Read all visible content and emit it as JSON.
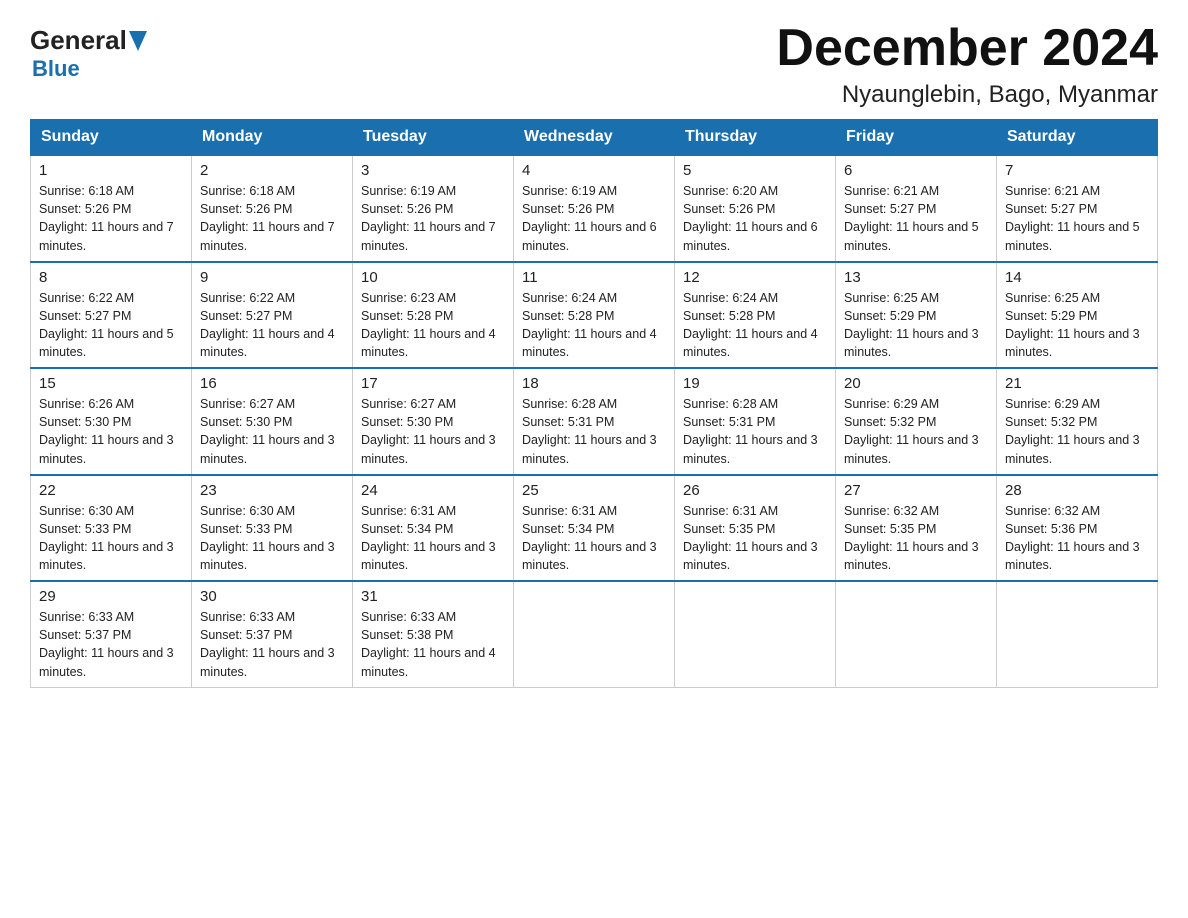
{
  "header": {
    "title": "December 2024",
    "subtitle": "Nyaunglebin, Bago, Myanmar"
  },
  "logo": {
    "part1": "General",
    "part2": "Blue"
  },
  "columns": [
    "Sunday",
    "Monday",
    "Tuesday",
    "Wednesday",
    "Thursday",
    "Friday",
    "Saturday"
  ],
  "weeks": [
    [
      {
        "day": "1",
        "sunrise": "6:18 AM",
        "sunset": "5:26 PM",
        "daylight": "11 hours and 7 minutes."
      },
      {
        "day": "2",
        "sunrise": "6:18 AM",
        "sunset": "5:26 PM",
        "daylight": "11 hours and 7 minutes."
      },
      {
        "day": "3",
        "sunrise": "6:19 AM",
        "sunset": "5:26 PM",
        "daylight": "11 hours and 7 minutes."
      },
      {
        "day": "4",
        "sunrise": "6:19 AM",
        "sunset": "5:26 PM",
        "daylight": "11 hours and 6 minutes."
      },
      {
        "day": "5",
        "sunrise": "6:20 AM",
        "sunset": "5:26 PM",
        "daylight": "11 hours and 6 minutes."
      },
      {
        "day": "6",
        "sunrise": "6:21 AM",
        "sunset": "5:27 PM",
        "daylight": "11 hours and 5 minutes."
      },
      {
        "day": "7",
        "sunrise": "6:21 AM",
        "sunset": "5:27 PM",
        "daylight": "11 hours and 5 minutes."
      }
    ],
    [
      {
        "day": "8",
        "sunrise": "6:22 AM",
        "sunset": "5:27 PM",
        "daylight": "11 hours and 5 minutes."
      },
      {
        "day": "9",
        "sunrise": "6:22 AM",
        "sunset": "5:27 PM",
        "daylight": "11 hours and 4 minutes."
      },
      {
        "day": "10",
        "sunrise": "6:23 AM",
        "sunset": "5:28 PM",
        "daylight": "11 hours and 4 minutes."
      },
      {
        "day": "11",
        "sunrise": "6:24 AM",
        "sunset": "5:28 PM",
        "daylight": "11 hours and 4 minutes."
      },
      {
        "day": "12",
        "sunrise": "6:24 AM",
        "sunset": "5:28 PM",
        "daylight": "11 hours and 4 minutes."
      },
      {
        "day": "13",
        "sunrise": "6:25 AM",
        "sunset": "5:29 PM",
        "daylight": "11 hours and 3 minutes."
      },
      {
        "day": "14",
        "sunrise": "6:25 AM",
        "sunset": "5:29 PM",
        "daylight": "11 hours and 3 minutes."
      }
    ],
    [
      {
        "day": "15",
        "sunrise": "6:26 AM",
        "sunset": "5:30 PM",
        "daylight": "11 hours and 3 minutes."
      },
      {
        "day": "16",
        "sunrise": "6:27 AM",
        "sunset": "5:30 PM",
        "daylight": "11 hours and 3 minutes."
      },
      {
        "day": "17",
        "sunrise": "6:27 AM",
        "sunset": "5:30 PM",
        "daylight": "11 hours and 3 minutes."
      },
      {
        "day": "18",
        "sunrise": "6:28 AM",
        "sunset": "5:31 PM",
        "daylight": "11 hours and 3 minutes."
      },
      {
        "day": "19",
        "sunrise": "6:28 AM",
        "sunset": "5:31 PM",
        "daylight": "11 hours and 3 minutes."
      },
      {
        "day": "20",
        "sunrise": "6:29 AM",
        "sunset": "5:32 PM",
        "daylight": "11 hours and 3 minutes."
      },
      {
        "day": "21",
        "sunrise": "6:29 AM",
        "sunset": "5:32 PM",
        "daylight": "11 hours and 3 minutes."
      }
    ],
    [
      {
        "day": "22",
        "sunrise": "6:30 AM",
        "sunset": "5:33 PM",
        "daylight": "11 hours and 3 minutes."
      },
      {
        "day": "23",
        "sunrise": "6:30 AM",
        "sunset": "5:33 PM",
        "daylight": "11 hours and 3 minutes."
      },
      {
        "day": "24",
        "sunrise": "6:31 AM",
        "sunset": "5:34 PM",
        "daylight": "11 hours and 3 minutes."
      },
      {
        "day": "25",
        "sunrise": "6:31 AM",
        "sunset": "5:34 PM",
        "daylight": "11 hours and 3 minutes."
      },
      {
        "day": "26",
        "sunrise": "6:31 AM",
        "sunset": "5:35 PM",
        "daylight": "11 hours and 3 minutes."
      },
      {
        "day": "27",
        "sunrise": "6:32 AM",
        "sunset": "5:35 PM",
        "daylight": "11 hours and 3 minutes."
      },
      {
        "day": "28",
        "sunrise": "6:32 AM",
        "sunset": "5:36 PM",
        "daylight": "11 hours and 3 minutes."
      }
    ],
    [
      {
        "day": "29",
        "sunrise": "6:33 AM",
        "sunset": "5:37 PM",
        "daylight": "11 hours and 3 minutes."
      },
      {
        "day": "30",
        "sunrise": "6:33 AM",
        "sunset": "5:37 PM",
        "daylight": "11 hours and 3 minutes."
      },
      {
        "day": "31",
        "sunrise": "6:33 AM",
        "sunset": "5:38 PM",
        "daylight": "11 hours and 4 minutes."
      },
      null,
      null,
      null,
      null
    ]
  ]
}
